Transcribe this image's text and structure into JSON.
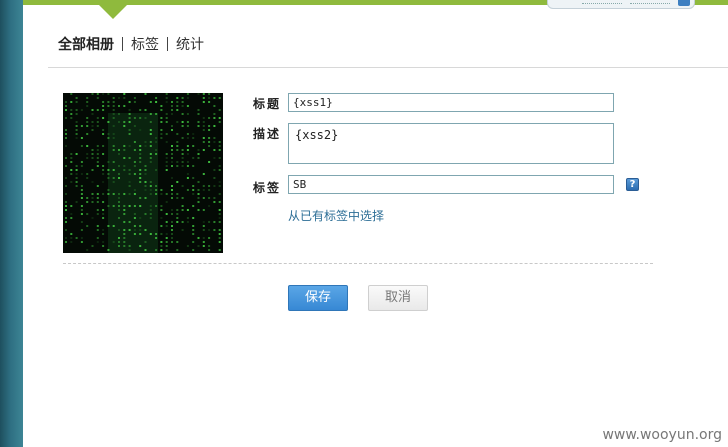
{
  "nav": {
    "items": [
      {
        "label": "全部相册",
        "active": true
      },
      {
        "label": "标签",
        "active": false
      },
      {
        "label": "统计",
        "active": false
      }
    ]
  },
  "photo": {
    "alt": "matrix-style-photo",
    "colors": {
      "background": "#040a05",
      "glyph": "#3fbf3f"
    }
  },
  "form": {
    "title_label": "标题",
    "title_value": "{xss1}",
    "desc_label": "描述",
    "desc_value": "{xss2}",
    "tag_label": "标签",
    "tag_value": "SB",
    "help_icon": "?",
    "pick_tags_link": "从已有标签中选择"
  },
  "buttons": {
    "save": "保存",
    "cancel": "取消"
  },
  "watermark": "www.wooyun.org",
  "colors": {
    "accent_green": "#8fba3d",
    "button_blue": "#3788d4",
    "link": "#2c6e96"
  }
}
